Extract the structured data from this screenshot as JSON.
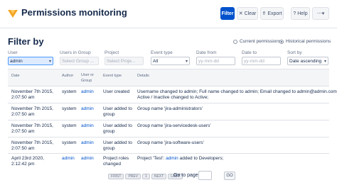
{
  "header": {
    "title": "Permissions monitoring",
    "buttons": {
      "filter": "Filter",
      "clear": "Clear",
      "export": "Export",
      "help": "Help"
    }
  },
  "filter": {
    "title": "Filter by",
    "radios": {
      "current": "Current permissions",
      "historical": "Historical permissions",
      "selected": "historical"
    },
    "fields": {
      "user": {
        "label": "User",
        "value": "admin"
      },
      "users_in_group": {
        "label": "Users in Group",
        "placeholder": "Select Group ..."
      },
      "project": {
        "label": "Project",
        "placeholder": "Select Proje..."
      },
      "event_type": {
        "label": "Event type",
        "value": "All"
      },
      "date_from": {
        "label": "Date from",
        "placeholder": "yy-mm-dd"
      },
      "date_to": {
        "label": "Date to",
        "placeholder": "yy-mm-dd"
      },
      "sort_by": {
        "label": "Sort by",
        "value": "Date ascending"
      }
    }
  },
  "table": {
    "headers": {
      "date": "Date",
      "author": "Author",
      "user_or_group": "User or Group",
      "event_type": "Event type",
      "details": "Details"
    },
    "rows": [
      {
        "date": "November 7th 2015, 2:07:50 am",
        "author": "system",
        "user_or_group": "admin",
        "event_type": "User created",
        "details_line1": "Username changed to admin; Full name changed to admin; Email changed to admin@admin.com;",
        "details_line2": "Active / Inactive changed to Active;"
      },
      {
        "date": "November 7th 2015, 2:07:50 am",
        "author": "system",
        "user_or_group": "admin",
        "event_type": "User added to group",
        "details_line1": "Group name 'jira-administrators'",
        "details_line2": ""
      },
      {
        "date": "November 7th 2015, 2:07:50 am",
        "author": "system",
        "user_or_group": "admin",
        "event_type": "User added to group",
        "details_line1": "Group name 'jira-servicedesk-users'",
        "details_line2": ""
      },
      {
        "date": "November 7th 2015, 2:07:50 am",
        "author": "system",
        "user_or_group": "admin",
        "event_type": "User added to group",
        "details_line1": "Group name 'jira-software-users'",
        "details_line2": ""
      },
      {
        "date": "April 23rd 2020, 2:12:42 pm",
        "author": "admin",
        "user_or_group": "admin",
        "event_type": "Project roles changed",
        "details_prefix": "Project 'Test':",
        "details_link": "admin",
        "details_suffix": "added to Developers;"
      }
    ]
  },
  "pagination": {
    "first": "FIRST",
    "prev": "PREV",
    "page": "1",
    "next": "NEXT",
    "last": "LAST",
    "goto_label": "Go to page:",
    "go": "GO"
  }
}
